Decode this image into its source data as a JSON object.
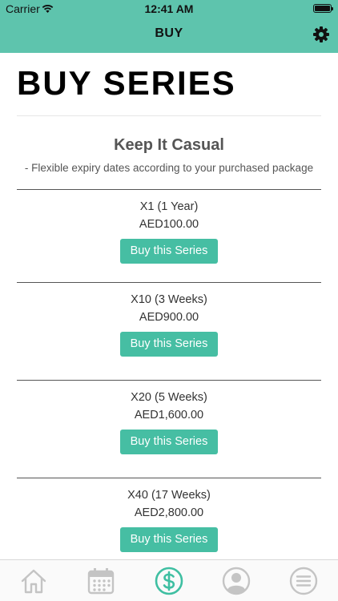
{
  "status_bar": {
    "carrier": "Carrier",
    "time": "12:41 AM"
  },
  "nav": {
    "title": "BUY",
    "settings_icon": "gear-icon"
  },
  "page": {
    "title": "BUY SERIES",
    "plan_name": "Keep It Casual",
    "plan_description": "- Flexible expiry dates according to your purchased package"
  },
  "packages": [
    {
      "name": "X1 (1 Year)",
      "price": "AED100.00",
      "button": "Buy this Series"
    },
    {
      "name": "X10 (3 Weeks)",
      "price": "AED900.00",
      "button": "Buy this Series"
    },
    {
      "name": "X20 (5 Weeks)",
      "price": "AED1,600.00",
      "button": "Buy this Series"
    },
    {
      "name": "X40 (17 Weeks)",
      "price": "AED2,800.00",
      "button": "Buy this Series"
    }
  ],
  "tabbar": {
    "items": [
      {
        "icon": "home-icon",
        "active": false
      },
      {
        "icon": "calendar-icon",
        "active": false
      },
      {
        "icon": "dollar-icon",
        "active": true
      },
      {
        "icon": "profile-icon",
        "active": false
      },
      {
        "icon": "menu-icon",
        "active": false
      }
    ]
  },
  "colors": {
    "header": "#5ec4ad",
    "button": "#46bea3",
    "tab_active": "#3fbfa2",
    "tab_inactive": "#c4c4c4"
  }
}
